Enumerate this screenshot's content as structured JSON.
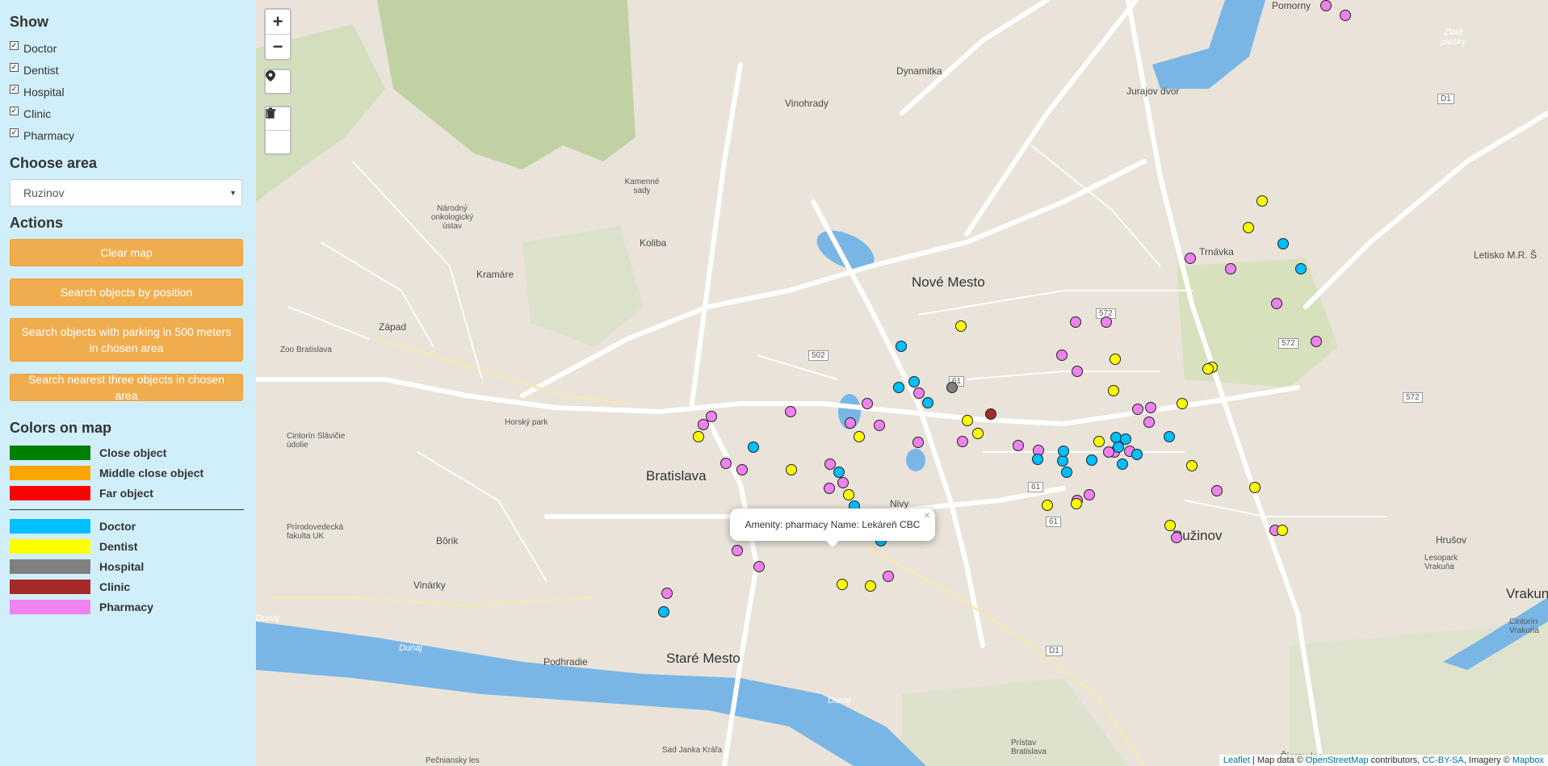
{
  "sidebar": {
    "show_title": "Show",
    "filters": [
      {
        "label": "Doctor",
        "checked": true
      },
      {
        "label": "Dentist",
        "checked": true
      },
      {
        "label": "Hospital",
        "checked": true
      },
      {
        "label": "Clinic",
        "checked": true
      },
      {
        "label": "Pharmacy",
        "checked": true
      }
    ],
    "area_title": "Choose area",
    "area_selected": "Ruzinov",
    "actions_title": "Actions",
    "actions": [
      "Clear map",
      "Search objects by position",
      "Search objects with parking in 500 meters in chosen area",
      "Search nearest three objects in chosen area"
    ],
    "colors_title": "Colors on map",
    "distance_legend": [
      {
        "label": "Close object",
        "color": "#008000"
      },
      {
        "label": "Middle close object",
        "color": "#ffa500"
      },
      {
        "label": "Far object",
        "color": "#ff0000"
      }
    ],
    "type_legend": [
      {
        "label": "Doctor",
        "color": "#00bfff"
      },
      {
        "label": "Dentist",
        "color": "#ffff00"
      },
      {
        "label": "Hospital",
        "color": "#808080"
      },
      {
        "label": "Clinic",
        "color": "#a52a2a"
      },
      {
        "label": "Pharmacy",
        "color": "#ee82ee"
      }
    ]
  },
  "map": {
    "zoom_in": "+",
    "zoom_out": "−",
    "locate_icon": "location-pin-icon",
    "edit_icon": "edit-icon",
    "delete_icon": "trash-icon",
    "labels": {
      "nove_mesto": "Nové Mesto",
      "bratislava": "Bratislava",
      "ruzinov": "Ružinov",
      "stare_mesto": "Staré Mesto",
      "dynamitka": "Dynamitka",
      "vinohrady": "Vinohrady",
      "jurajov_dvor": "Jurajov dvor",
      "kamenne_sady": "Kamenné sady",
      "narodny_ustav": "Národný onkologický ústav",
      "koliba": "Koliba",
      "kramare": "Kramáre",
      "zapad": "Západ",
      "zoo": "Zoo Bratislava",
      "trnavka": "Trnávka",
      "letisko": "Letisko M.R. Š",
      "nivy": "Nivy",
      "borik": "Bôrik",
      "vinarky": "Vinárky",
      "horsky_park": "Horský park",
      "podhradie": "Podhradie",
      "hrusov": "Hrušov",
      "cierny_les": "Čierny les",
      "dunaj": "Dunaj",
      "zlate_piesky": "Zlaté piesky",
      "vrakun": "Vrakun",
      "pomorny": "Pomorny",
      "cintorin_slavicie": "Cintorín Slávičie údolie",
      "prirodovedecka": "Prírodovedecká fakulta UK",
      "sad_janka_krala": "Sad Janka Kráľa",
      "pecniansky": "Pečniansky les",
      "pristav": "Prístav Bratislava",
      "leso_park": "Lesopark Vrakuňa",
      "cintorin_vrakuna": "Cintorín Vrakuňa",
      "road_572a": "572",
      "road_572b": "572",
      "road_572c": "572",
      "road_61a": "61",
      "road_61b": "61",
      "road_61c": "61",
      "road_502": "502",
      "road_d1a": "D1",
      "road_d1b": "D1"
    },
    "popup": {
      "text": "Amenity: pharmacy Name: Lekáreň CBC",
      "close": "×"
    },
    "attribution": {
      "leaflet": "Leaflet",
      "sep1": " | Map data © ",
      "osm": "OpenStreetMap",
      "sep2": " contributors, ",
      "cc": "CC-BY-SA",
      "sep3": ", Imagery © ",
      "mapbox": "Mapbox"
    },
    "markers": [
      {
        "type": "pharmacy",
        "color": "#ee82ee"
      },
      {
        "type": "pharmacy",
        "color": "#ee82ee"
      },
      {
        "type": "dentist",
        "color": "#ffff00"
      },
      {
        "type": "dentist",
        "color": "#ffff00"
      },
      {
        "type": "doctor",
        "color": "#00bfff"
      },
      {
        "type": "pharmacy",
        "color": "#ee82ee"
      },
      {
        "type": "doctor",
        "color": "#00bfff"
      },
      {
        "type": "pharmacy",
        "color": "#ee82ee"
      },
      {
        "type": "pharmacy",
        "color": "#ee82ee"
      },
      {
        "type": "pharmacy",
        "color": "#ee82ee"
      },
      {
        "type": "pharmacy",
        "color": "#ee82ee"
      },
      {
        "type": "dentist",
        "color": "#ffff00"
      },
      {
        "type": "dentist",
        "color": "#ffff00"
      },
      {
        "type": "doctor",
        "color": "#00bfff"
      },
      {
        "type": "pharmacy",
        "color": "#ee82ee"
      },
      {
        "type": "dentist",
        "color": "#ffff00"
      },
      {
        "type": "pharmacy",
        "color": "#ee82ee"
      },
      {
        "type": "dentist",
        "color": "#ffff00"
      },
      {
        "type": "pharmacy",
        "color": "#ee82ee"
      },
      {
        "type": "dentist",
        "color": "#ffff00"
      },
      {
        "type": "doctor",
        "color": "#00bfff"
      },
      {
        "type": "doctor",
        "color": "#00bfff"
      },
      {
        "type": "hospital",
        "color": "#808080"
      },
      {
        "type": "clinic",
        "color": "#a52a2a"
      },
      {
        "type": "pharmacy",
        "color": "#ee82ee"
      },
      {
        "type": "doctor",
        "color": "#00bfff"
      },
      {
        "type": "pharmacy",
        "color": "#ee82ee"
      },
      {
        "type": "dentist",
        "color": "#ffff00"
      },
      {
        "type": "pharmacy",
        "color": "#ee82ee"
      },
      {
        "type": "dentist",
        "color": "#ffff00"
      },
      {
        "type": "dentist",
        "color": "#ffff00"
      },
      {
        "type": "pharmacy",
        "color": "#ee82ee"
      },
      {
        "type": "pharmacy",
        "color": "#ee82ee"
      },
      {
        "type": "pharmacy",
        "color": "#ee82ee"
      },
      {
        "type": "pharmacy",
        "color": "#ee82ee"
      },
      {
        "type": "pharmacy",
        "color": "#ee82ee"
      },
      {
        "type": "doctor",
        "color": "#00bfff"
      },
      {
        "type": "pharmacy",
        "color": "#ee82ee"
      },
      {
        "type": "doctor",
        "color": "#00bfff"
      },
      {
        "type": "doctor",
        "color": "#00bfff"
      },
      {
        "type": "doctor",
        "color": "#00bfff"
      },
      {
        "type": "pharmacy",
        "color": "#ee82ee"
      },
      {
        "type": "dentist",
        "color": "#ffff00"
      },
      {
        "type": "pharmacy",
        "color": "#ee82ee"
      },
      {
        "type": "doctor",
        "color": "#00bfff"
      },
      {
        "type": "doctor",
        "color": "#00bfff"
      },
      {
        "type": "dentist",
        "color": "#ffff00"
      },
      {
        "type": "doctor",
        "color": "#00bfff"
      },
      {
        "type": "doctor",
        "color": "#00bfff"
      },
      {
        "type": "doctor",
        "color": "#00bfff"
      },
      {
        "type": "dentist",
        "color": "#ffff00"
      },
      {
        "type": "dentist",
        "color": "#ffff00"
      },
      {
        "type": "pharmacy",
        "color": "#ee82ee"
      },
      {
        "type": "pharmacy",
        "color": "#ee82ee"
      },
      {
        "type": "pharmacy",
        "color": "#ee82ee"
      },
      {
        "type": "doctor",
        "color": "#00bfff"
      },
      {
        "type": "doctor",
        "color": "#00bfff"
      },
      {
        "type": "dentist",
        "color": "#ffff00"
      },
      {
        "type": "pharmacy",
        "color": "#ee82ee"
      },
      {
        "type": "dentist",
        "color": "#ffff00"
      },
      {
        "type": "pharmacy",
        "color": "#ee82ee"
      },
      {
        "type": "pharmacy",
        "color": "#ee82ee"
      },
      {
        "type": "dentist",
        "color": "#ffff00"
      },
      {
        "type": "pharmacy",
        "color": "#ee82ee"
      },
      {
        "type": "dentist",
        "color": "#ffff00"
      },
      {
        "type": "pharmacy",
        "color": "#ee82ee"
      },
      {
        "type": "pharmacy",
        "color": "#ee82ee"
      },
      {
        "type": "pharmacy",
        "color": "#ee82ee"
      },
      {
        "type": "doctor",
        "color": "#00bfff"
      },
      {
        "type": "pharmacy",
        "color": "#ee82ee"
      },
      {
        "type": "dentist",
        "color": "#ffff00"
      },
      {
        "type": "dentist",
        "color": "#ffff00"
      },
      {
        "type": "pharmacy",
        "color": "#ee82ee"
      },
      {
        "type": "pharmacy",
        "color": "#ee82ee"
      },
      {
        "type": "pharmacy",
        "color": "#ee82ee"
      },
      {
        "type": "doctor",
        "color": "#00bfff"
      },
      {
        "type": "pharmacy",
        "color": "#ee82ee"
      },
      {
        "type": "pharmacy",
        "color": "#ee82ee"
      },
      {
        "type": "dentist",
        "color": "#ffff00"
      },
      {
        "type": "doctor",
        "color": "#00bfff"
      },
      {
        "type": "pharmacy",
        "color": "#ee82ee"
      },
      {
        "type": "pharmacy",
        "color": "#ee82ee"
      },
      {
        "type": "pharmacy",
        "color": "#ee82ee"
      },
      {
        "type": "doctor",
        "color": "#00bfff"
      },
      {
        "type": "pharmacy",
        "color": "#ee82ee"
      },
      {
        "type": "doctor",
        "color": "#00bfff"
      },
      {
        "type": "dentist",
        "color": "#ffff00"
      },
      {
        "type": "dentist",
        "color": "#ffff00"
      }
    ]
  }
}
